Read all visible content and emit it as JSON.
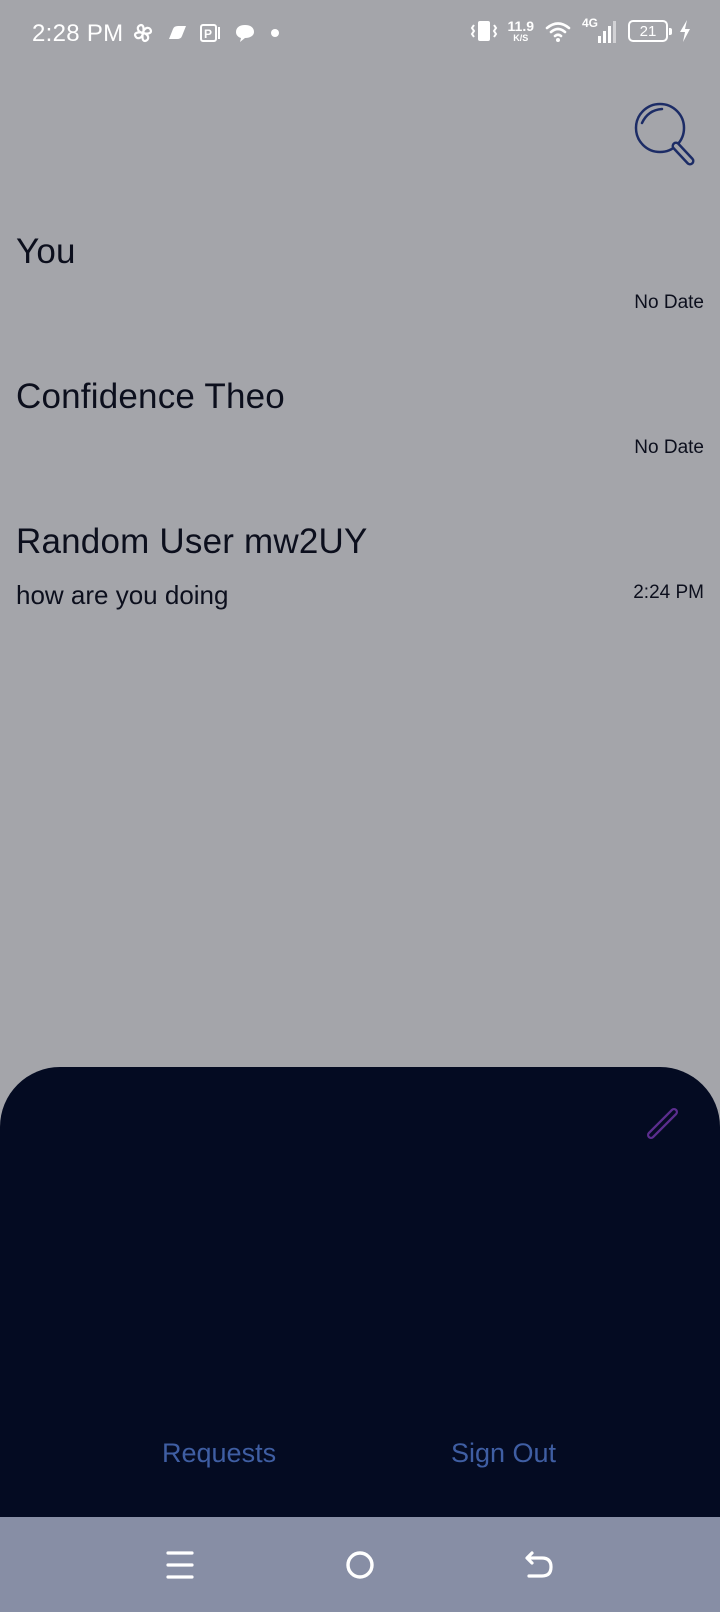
{
  "status_bar": {
    "time": "2:28 PM",
    "icons": [
      "pinwheel-icon",
      "cloud-icon",
      "p-app-icon",
      "chat-bubble-icon",
      "dot-icon"
    ],
    "speed_value": "11.9",
    "speed_unit": "K/S",
    "network_label": "4G",
    "battery_level": "21"
  },
  "header": {
    "search_icon": "search-icon"
  },
  "chats": [
    {
      "name": "You",
      "preview": "",
      "date": "No Date"
    },
    {
      "name": "Confidence Theo",
      "preview": "",
      "date": "No Date"
    },
    {
      "name": "Random User mw2UY",
      "preview": "how are you doing",
      "date": "2:24 PM"
    }
  ],
  "bottom_sheet": {
    "compose_icon": "pencil-icon",
    "requests_label": "Requests",
    "signout_label": "Sign Out"
  },
  "nav_bar": {
    "icons": [
      "menu-icon",
      "home-icon",
      "back-icon"
    ]
  },
  "colors": {
    "background": "#a4a5aa",
    "sheet": "#040b22",
    "link": "#3f5ea3",
    "search_icon": "#1c2c66",
    "compose_icon": "#5b2d8e",
    "nav_bar": "#878ea5"
  }
}
